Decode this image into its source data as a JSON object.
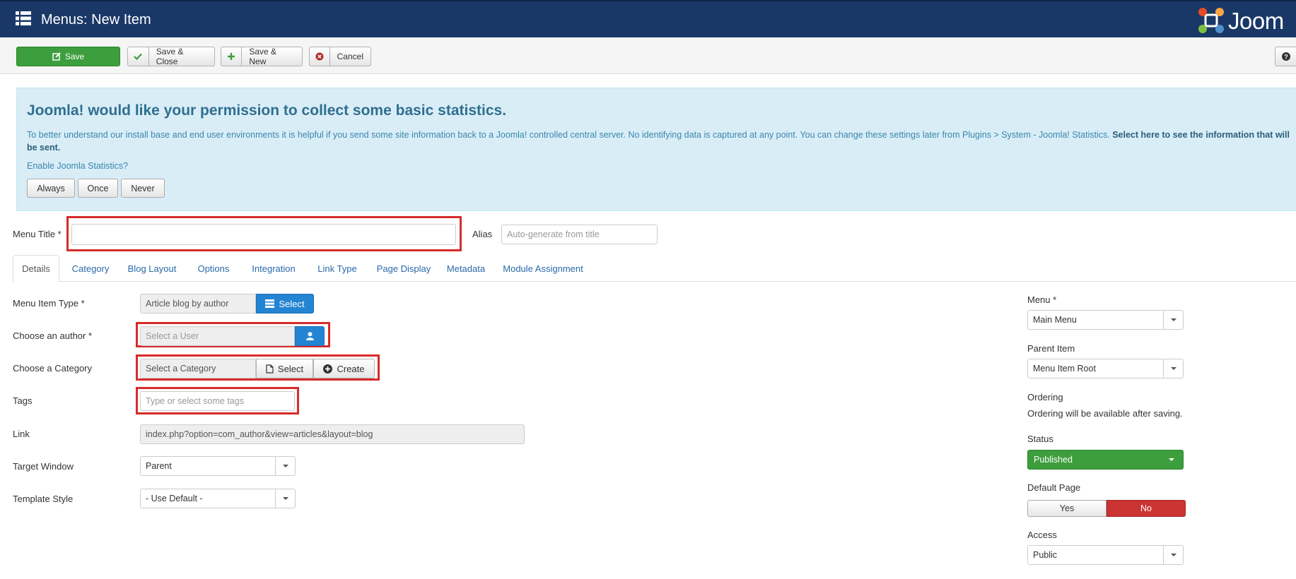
{
  "header": {
    "title": "Menus: New Item",
    "logo_text": "Joom",
    "icons": {
      "menu": "grid-icon",
      "logo": "joomla-logo"
    }
  },
  "toolbar": {
    "save": "Save",
    "save_close": "Save & Close",
    "save_new": "Save & New",
    "cancel": "Cancel",
    "help_icon": "help-icon"
  },
  "stats": {
    "heading": "Joomla! would like your permission to collect some basic statistics.",
    "message": "To better understand our install base and end user environments it is helpful if you send some site information back to a Joomla! controlled central server. No identifying data is captured at any point. You can change these settings later from Plugins > System - Joomla! Statistics.",
    "message_bold": "Select here to see the information that will be sent.",
    "question": "Enable Joomla Statistics?",
    "buttons": [
      "Always",
      "Once",
      "Never"
    ]
  },
  "title_row": {
    "menu_title_label": "Menu Title *",
    "menu_title_value": "",
    "alias_label": "Alias",
    "alias_placeholder": "Auto-generate from title"
  },
  "tabs": [
    "Details",
    "Category",
    "Blog Layout",
    "Options",
    "Integration",
    "Link Type",
    "Page Display",
    "Metadata",
    "Module Assignment"
  ],
  "details": {
    "menu_item_type": {
      "label": "Menu Item Type *",
      "value": "Article blog by author",
      "button": "Select"
    },
    "author": {
      "label": "Choose an author *",
      "placeholder": "Select a User"
    },
    "category": {
      "label": "Choose a Category",
      "value": "Select a Category",
      "select": "Select",
      "create": "Create"
    },
    "tags": {
      "label": "Tags",
      "placeholder": "Type or select some tags"
    },
    "link": {
      "label": "Link",
      "value": "index.php?option=com_author&view=articles&layout=blog"
    },
    "target_window": {
      "label": "Target Window",
      "value": "Parent"
    },
    "template_style": {
      "label": "Template Style",
      "value": "- Use Default -"
    }
  },
  "sidebar": {
    "menu": {
      "label": "Menu *",
      "value": "Main Menu"
    },
    "parent": {
      "label": "Parent Item",
      "value": "Menu Item Root"
    },
    "ordering": {
      "label": "Ordering",
      "note": "Ordering will be available after saving."
    },
    "status": {
      "label": "Status",
      "value": "Published"
    },
    "default_page": {
      "label": "Default Page",
      "yes": "Yes",
      "no": "No"
    },
    "access": {
      "label": "Access",
      "value": "Public"
    }
  },
  "colors": {
    "header": "#1a3867",
    "save": "#3c9e3c",
    "primary": "#2384d3",
    "alert_bg": "#d9edf7",
    "highlight": "#d62b2b",
    "no_toggle": "#cc3333"
  }
}
